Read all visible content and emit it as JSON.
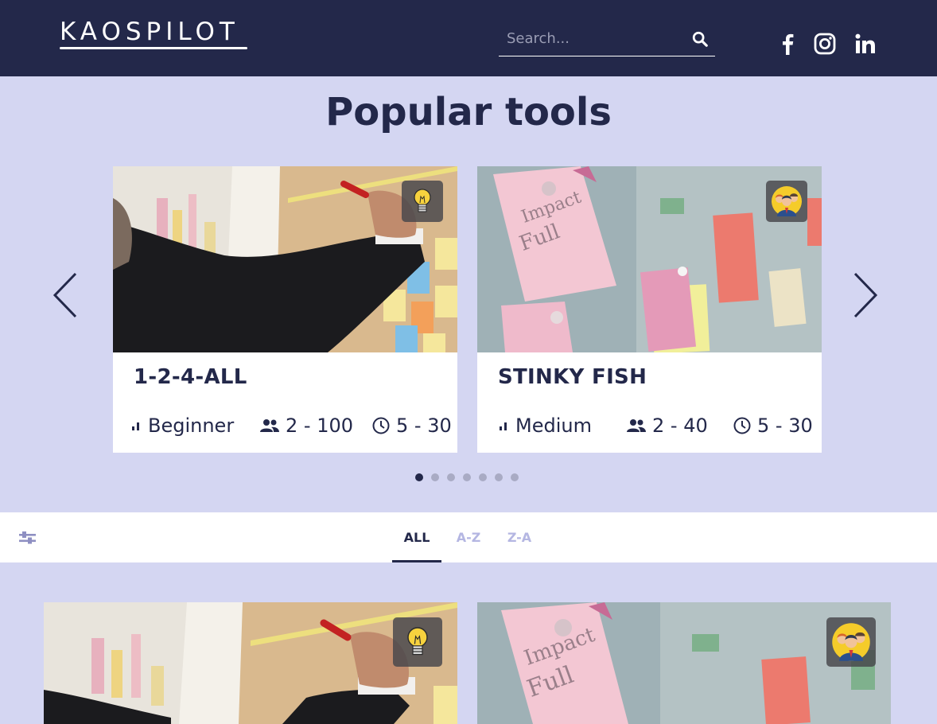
{
  "header": {
    "logo": "KAOSPILOT",
    "search_placeholder": "Search...",
    "social": [
      "facebook-icon",
      "instagram-icon",
      "linkedin-icon"
    ]
  },
  "popular": {
    "title": "Popular tools",
    "cards": [
      {
        "title": "1-2-4-ALL",
        "level": "Beginner",
        "participants": "2 - 100",
        "duration": "5 - 30",
        "badge": "lightbulb-icon"
      },
      {
        "title": "STINKY FISH",
        "level": "Medium",
        "participants": "2 - 40",
        "duration": "5 - 30",
        "badge": "team-icon"
      }
    ],
    "pagination": {
      "total": 7,
      "current": 1
    }
  },
  "filter": {
    "tabs": [
      "ALL",
      "A-Z",
      "Z-A"
    ],
    "active_tab": "ALL"
  },
  "colors": {
    "navy": "#23284a",
    "lavender": "#d4d6f2",
    "inactive_tab": "#b4b6e2"
  }
}
